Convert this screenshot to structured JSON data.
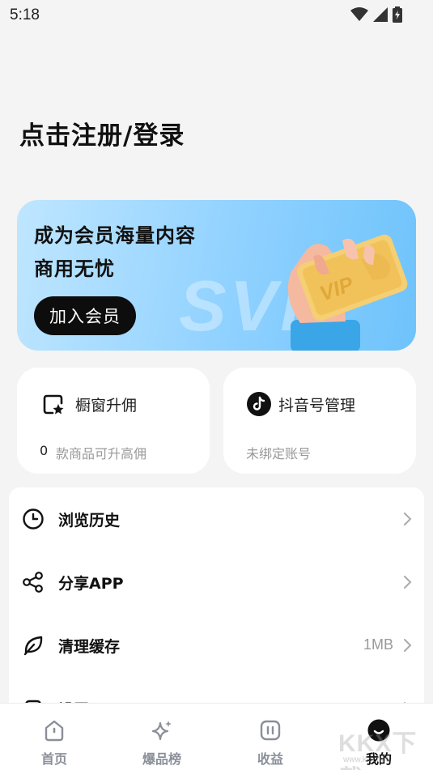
{
  "status": {
    "time": "5:18"
  },
  "header": {
    "login_title": "点击注册/登录"
  },
  "vip_banner": {
    "line1": "成为会员海量内容",
    "line2": "商用无忧",
    "join_label": "加入会员",
    "watermark_text": "SVIP",
    "card_text": "VIP"
  },
  "cards": {
    "window_commission": {
      "title": "橱窗升佣",
      "count": "0",
      "sub": "款商品可升高佣"
    },
    "douyin_manage": {
      "title": "抖音号管理",
      "sub": "未绑定账号"
    }
  },
  "menu": {
    "items": [
      {
        "label": "浏览历史",
        "value": ""
      },
      {
        "label": "分享APP",
        "value": ""
      },
      {
        "label": "清理缓存",
        "value": "1MB"
      },
      {
        "label": "设置",
        "value": ""
      }
    ]
  },
  "bottom_nav": {
    "items": [
      {
        "label": "首页"
      },
      {
        "label": "爆品榜"
      },
      {
        "label": "收益"
      },
      {
        "label": "我的"
      }
    ]
  },
  "watermark": {
    "text": "KKX下载",
    "sub": "www.kkx.net"
  },
  "colors": {
    "accent": "#0d0d0d",
    "banner_start": "#bfe6ff",
    "banner_end": "#6ec3fb",
    "muted": "#999999"
  }
}
